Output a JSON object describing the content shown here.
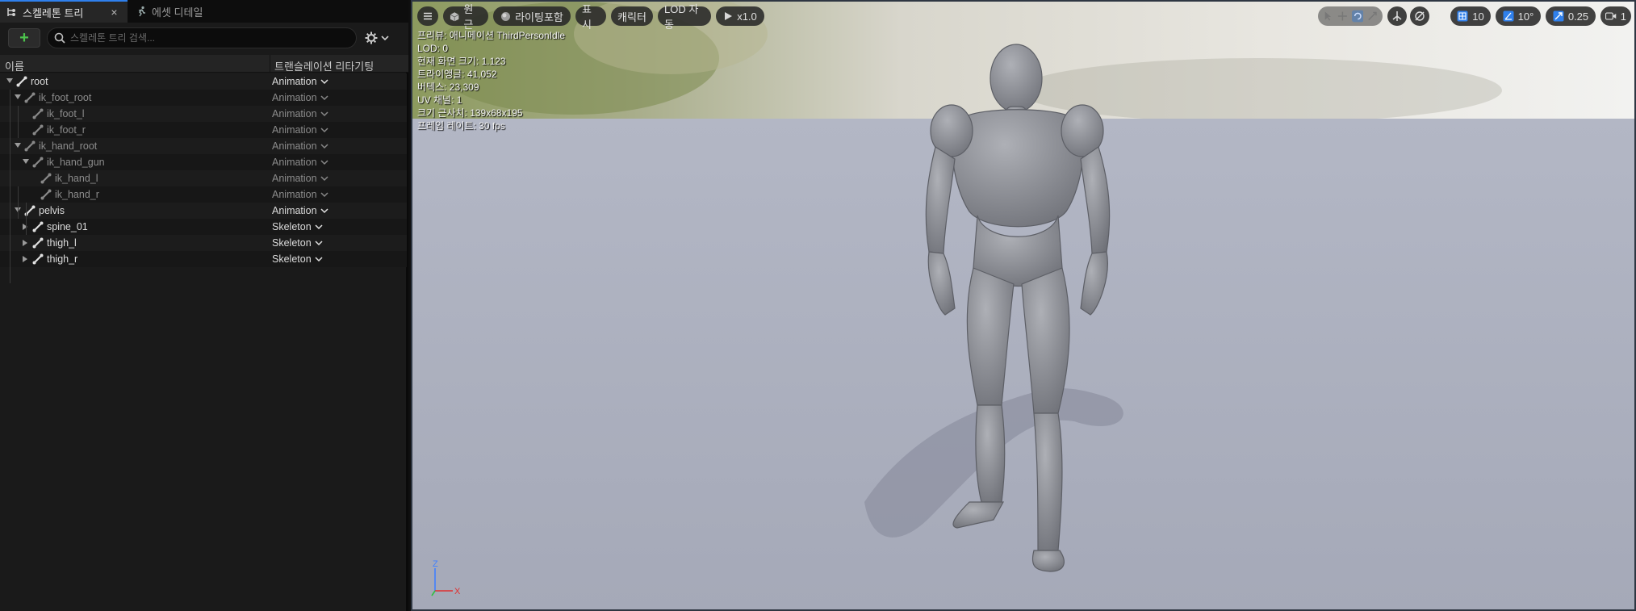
{
  "tabs": [
    {
      "label": "스켈레톤 트리",
      "active": true,
      "close": "×"
    },
    {
      "label": "에셋 디테일",
      "active": false
    }
  ],
  "toolbar": {
    "add_label": "+",
    "search_placeholder": "스켈레톤 트리 검색..."
  },
  "columns": {
    "name": "이름",
    "retarget": "트랜슬레이션 리타기팅"
  },
  "tree": [
    {
      "label": "root",
      "mode": "Animation",
      "expanded": true,
      "bright": true
    },
    {
      "label": "ik_foot_root",
      "mode": "Animation",
      "expanded": true,
      "bright": false
    },
    {
      "label": "ik_foot_l",
      "mode": "Animation",
      "bright": false
    },
    {
      "label": "ik_foot_r",
      "mode": "Animation",
      "bright": false
    },
    {
      "label": "ik_hand_root",
      "mode": "Animation",
      "expanded": true,
      "bright": false
    },
    {
      "label": "ik_hand_gun",
      "mode": "Animation",
      "expanded": true,
      "bright": false
    },
    {
      "label": "ik_hand_l",
      "mode": "Animation",
      "bright": false
    },
    {
      "label": "ik_hand_r",
      "mode": "Animation",
      "bright": false
    },
    {
      "label": "pelvis",
      "mode": "Animation",
      "expanded": true,
      "bright": true
    },
    {
      "label": "spine_01",
      "mode": "Skeleton",
      "collapsed": true,
      "bright": true
    },
    {
      "label": "thigh_l",
      "mode": "Skeleton",
      "collapsed": true,
      "bright": true
    },
    {
      "label": "thigh_r",
      "mode": "Skeleton",
      "collapsed": true,
      "bright": true
    }
  ],
  "viewport_toolbar": {
    "perspective": "원근",
    "lighting": "라이팅포함",
    "show": "표시",
    "character": "캐릭터",
    "lod": "LOD 자동",
    "play_speed": "x1.0",
    "grid_size": "10",
    "rotation_snap": "10°",
    "scale_snap": "0.25",
    "camera_speed": "1"
  },
  "stats": [
    "프리뷰: 애니메이션 ThirdPersonIdle",
    "LOD: 0",
    "현재 화면 크기: 1.123",
    "트라이앵글: 41,052",
    "버텍스: 23,309",
    "UV 채널: 1",
    "크기 근사치: 139x68x195",
    "프레임 레이트: 30 fps"
  ],
  "axis": {
    "z": "Z",
    "x": "X"
  },
  "colors": {
    "accent": "#2f80ed",
    "axis_x": "#e03030",
    "axis_y": "#30c040",
    "axis_z": "#4080ff"
  }
}
